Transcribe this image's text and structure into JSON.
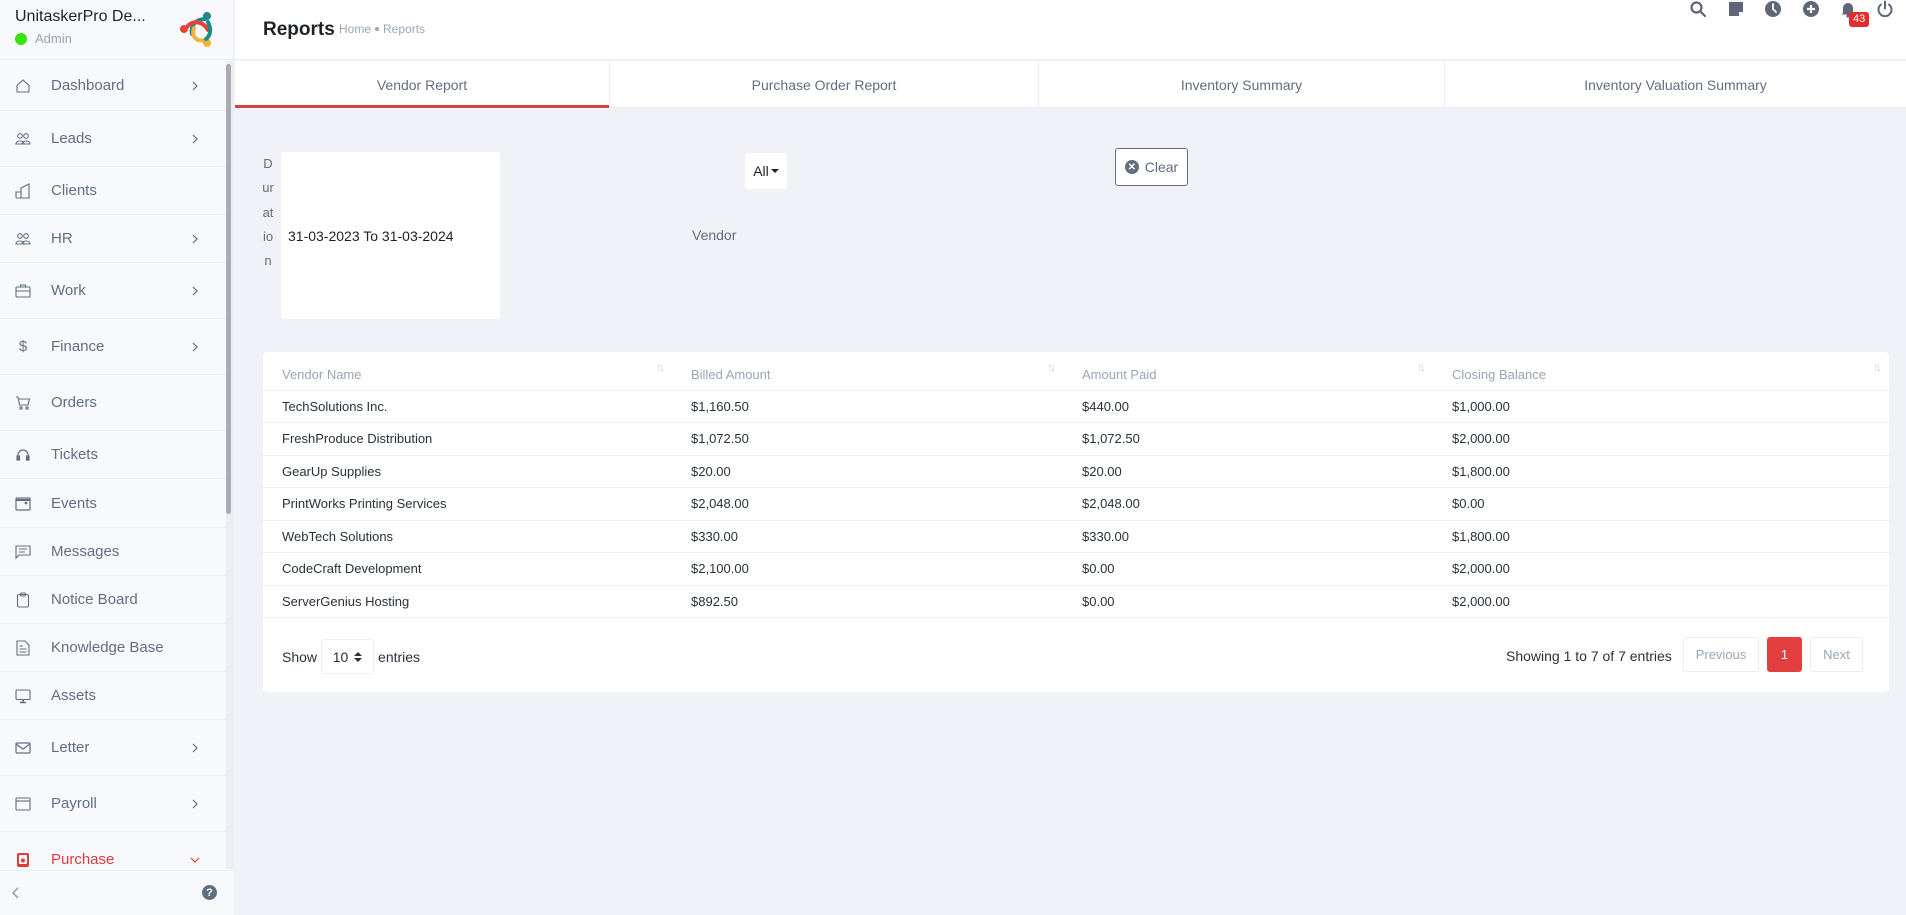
{
  "sidebar": {
    "company": "UnitaskerPro De...",
    "role": "Admin",
    "items": [
      {
        "label": "Dashboard",
        "icon": "home-icon",
        "has_children": true
      },
      {
        "label": "Leads",
        "icon": "users-icon",
        "has_children": true
      },
      {
        "label": "Clients",
        "icon": "building-icon",
        "has_children": false
      },
      {
        "label": "HR",
        "icon": "people-icon",
        "has_children": true
      },
      {
        "label": "Work",
        "icon": "briefcase-icon",
        "has_children": true
      },
      {
        "label": "Finance",
        "icon": "dollar-icon",
        "has_children": true
      },
      {
        "label": "Orders",
        "icon": "cart-icon",
        "has_children": false
      },
      {
        "label": "Tickets",
        "icon": "headset-icon",
        "has_children": false
      },
      {
        "label": "Events",
        "icon": "calendar-icon",
        "has_children": false
      },
      {
        "label": "Messages",
        "icon": "chat-icon",
        "has_children": false
      },
      {
        "label": "Notice Board",
        "icon": "clipboard-icon",
        "has_children": false
      },
      {
        "label": "Knowledge Base",
        "icon": "document-icon",
        "has_children": false
      },
      {
        "label": "Assets",
        "icon": "monitor-icon",
        "has_children": false
      },
      {
        "label": "Letter",
        "icon": "envelope-icon",
        "has_children": true
      },
      {
        "label": "Payroll",
        "icon": "wallet-icon",
        "has_children": true
      },
      {
        "label": "Purchase",
        "icon": "purchase-icon",
        "has_children": true,
        "active": true
      }
    ],
    "help_label": "?"
  },
  "header": {
    "title": "Reports",
    "breadcrumb": [
      "Home",
      "Reports"
    ],
    "notification_count": "43"
  },
  "tabs": [
    {
      "label": "Vendor Report",
      "active": true
    },
    {
      "label": "Purchase Order Report"
    },
    {
      "label": "Inventory Summary"
    },
    {
      "label": "Inventory Valuation Summary"
    }
  ],
  "filters": {
    "duration_label": "Duration",
    "duration_value": "31-03-2023 To 31-03-2024",
    "vendor_label": "Vendor",
    "vendor_value": "All",
    "clear_label": "Clear"
  },
  "table": {
    "columns": [
      "Vendor Name",
      "Billed Amount",
      "Amount Paid",
      "Closing Balance"
    ],
    "rows": [
      [
        "TechSolutions Inc.",
        "$1,160.50",
        "$440.00",
        "$1,000.00"
      ],
      [
        "FreshProduce Distribution",
        "$1,072.50",
        "$1,072.50",
        "$2,000.00"
      ],
      [
        "GearUp Supplies",
        "$20.00",
        "$20.00",
        "$1,800.00"
      ],
      [
        "PrintWorks Printing Services",
        "$2,048.00",
        "$2,048.00",
        "$0.00"
      ],
      [
        "WebTech Solutions",
        "$330.00",
        "$330.00",
        "$1,800.00"
      ],
      [
        "CodeCraft Development",
        "$2,100.00",
        "$0.00",
        "$2,000.00"
      ],
      [
        "ServerGenius Hosting",
        "$892.50",
        "$0.00",
        "$2,000.00"
      ]
    ],
    "show_label": "Show",
    "page_length": "10",
    "entries_label": "entries",
    "info": "Showing 1 to 7 of 7 entries",
    "prev_label": "Previous",
    "current_page": "1",
    "next_label": "Next"
  },
  "colors": {
    "accent": "#e23a3a",
    "online": "#39e500"
  }
}
